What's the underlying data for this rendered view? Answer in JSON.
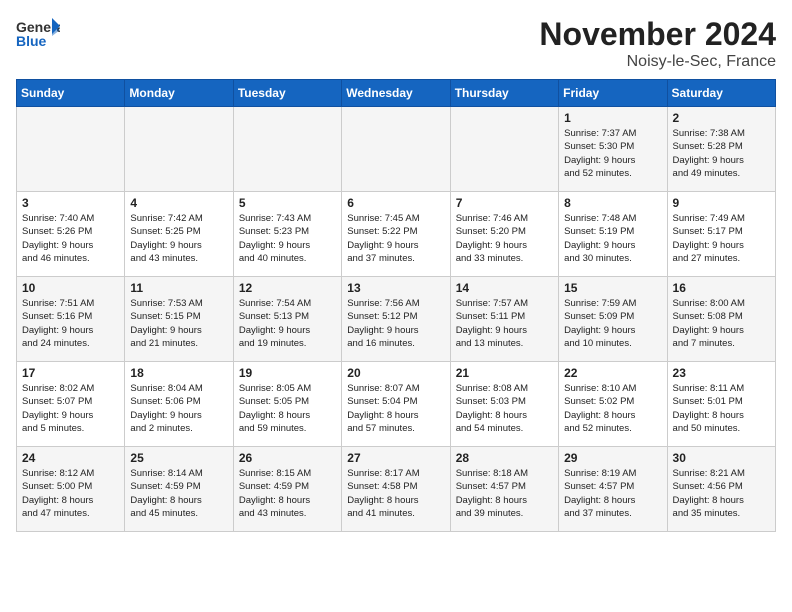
{
  "header": {
    "logo_general": "General",
    "logo_blue": "Blue",
    "month_title": "November 2024",
    "location": "Noisy-le-Sec, France"
  },
  "days_of_week": [
    "Sunday",
    "Monday",
    "Tuesday",
    "Wednesday",
    "Thursday",
    "Friday",
    "Saturday"
  ],
  "weeks": [
    [
      {
        "day": "",
        "info": ""
      },
      {
        "day": "",
        "info": ""
      },
      {
        "day": "",
        "info": ""
      },
      {
        "day": "",
        "info": ""
      },
      {
        "day": "",
        "info": ""
      },
      {
        "day": "1",
        "info": "Sunrise: 7:37 AM\nSunset: 5:30 PM\nDaylight: 9 hours\nand 52 minutes."
      },
      {
        "day": "2",
        "info": "Sunrise: 7:38 AM\nSunset: 5:28 PM\nDaylight: 9 hours\nand 49 minutes."
      }
    ],
    [
      {
        "day": "3",
        "info": "Sunrise: 7:40 AM\nSunset: 5:26 PM\nDaylight: 9 hours\nand 46 minutes."
      },
      {
        "day": "4",
        "info": "Sunrise: 7:42 AM\nSunset: 5:25 PM\nDaylight: 9 hours\nand 43 minutes."
      },
      {
        "day": "5",
        "info": "Sunrise: 7:43 AM\nSunset: 5:23 PM\nDaylight: 9 hours\nand 40 minutes."
      },
      {
        "day": "6",
        "info": "Sunrise: 7:45 AM\nSunset: 5:22 PM\nDaylight: 9 hours\nand 37 minutes."
      },
      {
        "day": "7",
        "info": "Sunrise: 7:46 AM\nSunset: 5:20 PM\nDaylight: 9 hours\nand 33 minutes."
      },
      {
        "day": "8",
        "info": "Sunrise: 7:48 AM\nSunset: 5:19 PM\nDaylight: 9 hours\nand 30 minutes."
      },
      {
        "day": "9",
        "info": "Sunrise: 7:49 AM\nSunset: 5:17 PM\nDaylight: 9 hours\nand 27 minutes."
      }
    ],
    [
      {
        "day": "10",
        "info": "Sunrise: 7:51 AM\nSunset: 5:16 PM\nDaylight: 9 hours\nand 24 minutes."
      },
      {
        "day": "11",
        "info": "Sunrise: 7:53 AM\nSunset: 5:15 PM\nDaylight: 9 hours\nand 21 minutes."
      },
      {
        "day": "12",
        "info": "Sunrise: 7:54 AM\nSunset: 5:13 PM\nDaylight: 9 hours\nand 19 minutes."
      },
      {
        "day": "13",
        "info": "Sunrise: 7:56 AM\nSunset: 5:12 PM\nDaylight: 9 hours\nand 16 minutes."
      },
      {
        "day": "14",
        "info": "Sunrise: 7:57 AM\nSunset: 5:11 PM\nDaylight: 9 hours\nand 13 minutes."
      },
      {
        "day": "15",
        "info": "Sunrise: 7:59 AM\nSunset: 5:09 PM\nDaylight: 9 hours\nand 10 minutes."
      },
      {
        "day": "16",
        "info": "Sunrise: 8:00 AM\nSunset: 5:08 PM\nDaylight: 9 hours\nand 7 minutes."
      }
    ],
    [
      {
        "day": "17",
        "info": "Sunrise: 8:02 AM\nSunset: 5:07 PM\nDaylight: 9 hours\nand 5 minutes."
      },
      {
        "day": "18",
        "info": "Sunrise: 8:04 AM\nSunset: 5:06 PM\nDaylight: 9 hours\nand 2 minutes."
      },
      {
        "day": "19",
        "info": "Sunrise: 8:05 AM\nSunset: 5:05 PM\nDaylight: 8 hours\nand 59 minutes."
      },
      {
        "day": "20",
        "info": "Sunrise: 8:07 AM\nSunset: 5:04 PM\nDaylight: 8 hours\nand 57 minutes."
      },
      {
        "day": "21",
        "info": "Sunrise: 8:08 AM\nSunset: 5:03 PM\nDaylight: 8 hours\nand 54 minutes."
      },
      {
        "day": "22",
        "info": "Sunrise: 8:10 AM\nSunset: 5:02 PM\nDaylight: 8 hours\nand 52 minutes."
      },
      {
        "day": "23",
        "info": "Sunrise: 8:11 AM\nSunset: 5:01 PM\nDaylight: 8 hours\nand 50 minutes."
      }
    ],
    [
      {
        "day": "24",
        "info": "Sunrise: 8:12 AM\nSunset: 5:00 PM\nDaylight: 8 hours\nand 47 minutes."
      },
      {
        "day": "25",
        "info": "Sunrise: 8:14 AM\nSunset: 4:59 PM\nDaylight: 8 hours\nand 45 minutes."
      },
      {
        "day": "26",
        "info": "Sunrise: 8:15 AM\nSunset: 4:59 PM\nDaylight: 8 hours\nand 43 minutes."
      },
      {
        "day": "27",
        "info": "Sunrise: 8:17 AM\nSunset: 4:58 PM\nDaylight: 8 hours\nand 41 minutes."
      },
      {
        "day": "28",
        "info": "Sunrise: 8:18 AM\nSunset: 4:57 PM\nDaylight: 8 hours\nand 39 minutes."
      },
      {
        "day": "29",
        "info": "Sunrise: 8:19 AM\nSunset: 4:57 PM\nDaylight: 8 hours\nand 37 minutes."
      },
      {
        "day": "30",
        "info": "Sunrise: 8:21 AM\nSunset: 4:56 PM\nDaylight: 8 hours\nand 35 minutes."
      }
    ]
  ]
}
